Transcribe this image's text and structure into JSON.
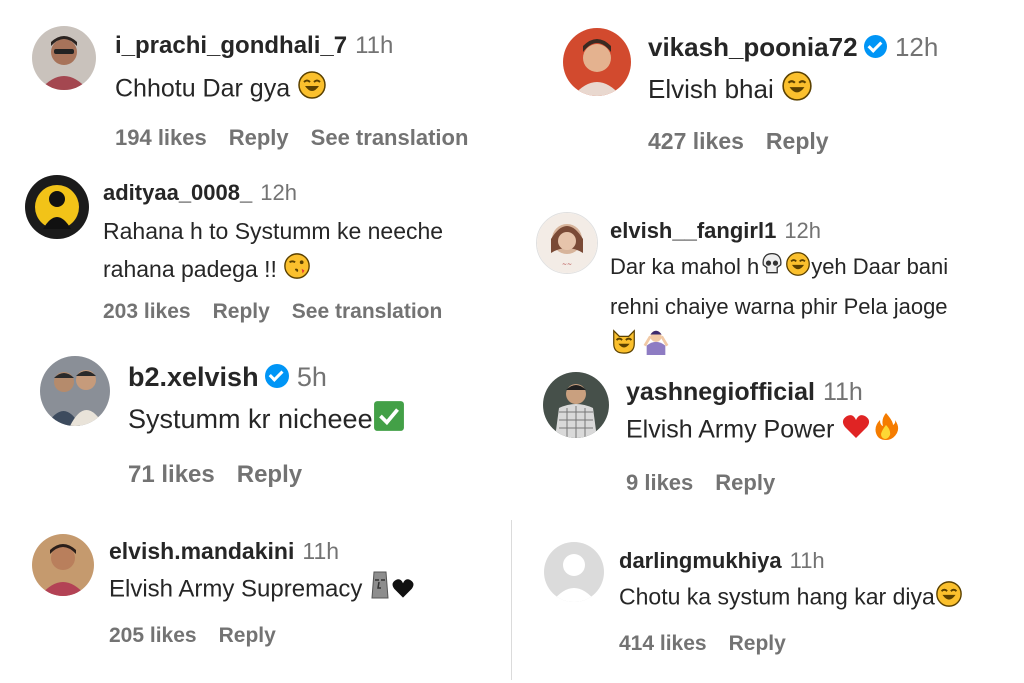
{
  "comments": [
    {
      "username": "i_prachi_gondhali_7",
      "time": "11h",
      "text": "Chhotu Dar gya",
      "likes": "194 likes",
      "reply": "Reply",
      "translate": "See translation"
    },
    {
      "username": "vikash_poonia72",
      "time": "12h",
      "text": "Elvish bhai",
      "likes": "427 likes",
      "reply": "Reply"
    },
    {
      "username": "adityaa_0008_",
      "time": "12h",
      "text_line1": "Rahana h to Systumm ke neeche",
      "text_line2": "rahana padega !!",
      "likes": "203 likes",
      "reply": "Reply",
      "translate": "See translation"
    },
    {
      "username": "elvish__fangirl1",
      "time": "12h",
      "text_line1_a": "Dar ka mahol h",
      "text_line1_b": "yeh Daar bani",
      "text_line2": "rehni chaiye warna phir Pela jaoge"
    },
    {
      "username": "b2.xelvish",
      "time": "5h",
      "text": "Systumm kr nicheee",
      "likes": "71 likes",
      "reply": "Reply"
    },
    {
      "username": "yashnegiofficial",
      "time": "11h",
      "text": "Elvish Army Power",
      "likes": "9 likes",
      "reply": "Reply"
    },
    {
      "username": "elvish.mandakini",
      "time": "11h",
      "text": "Elvish Army Supremacy",
      "likes": "205 likes",
      "reply": "Reply"
    },
    {
      "username": "darlingmukhiya",
      "time": "11h",
      "text": "Chotu ka systum hang kar diya",
      "likes": "414 likes",
      "reply": "Reply"
    }
  ],
  "colors": {
    "text": "#262626",
    "muted": "#737373",
    "verified": "#0095f6",
    "divider": "#dbdbdb"
  }
}
